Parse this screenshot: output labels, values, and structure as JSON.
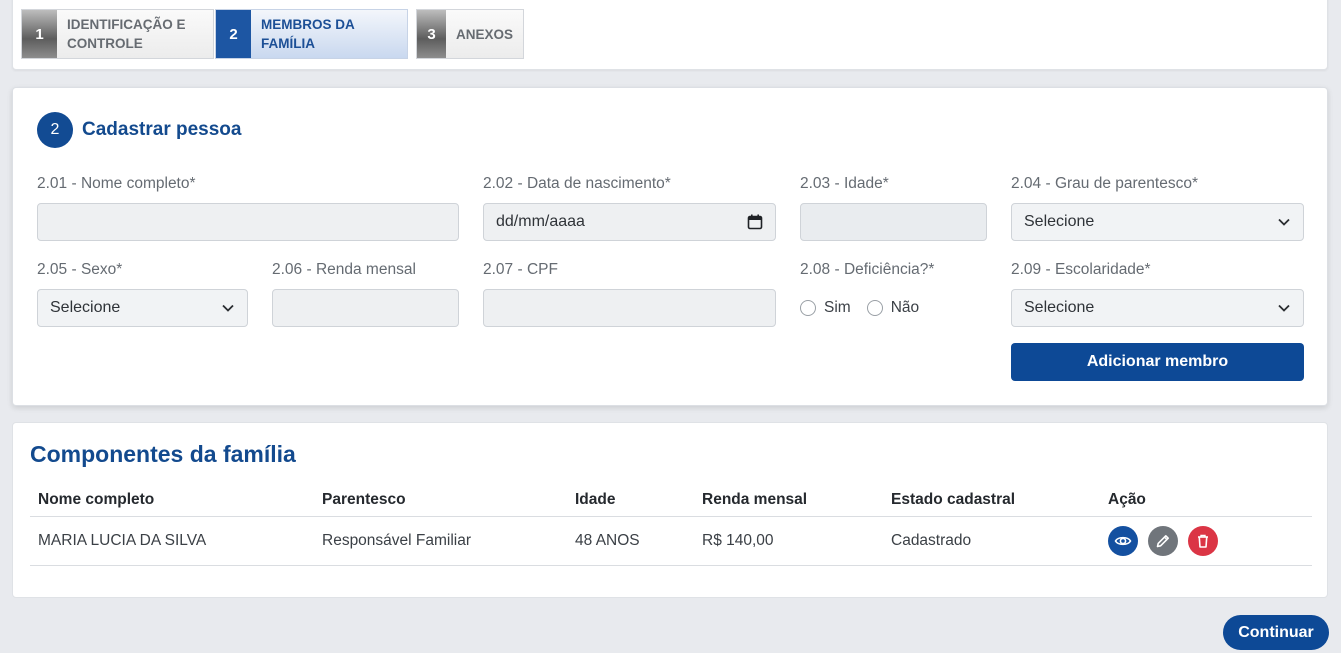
{
  "stepper": {
    "steps": [
      {
        "number": "1",
        "label_line1": "IDENTIFICAÇÃO E",
        "label_line2": "CONTROLE"
      },
      {
        "number": "2",
        "label_line1": "MEMBROS DA",
        "label_line2": "FAMÍLIA"
      },
      {
        "number": "3",
        "label_line1": "ANEXOS",
        "label_line2": ""
      }
    ],
    "active_step": 2
  },
  "form": {
    "section_number": "2",
    "section_title": "Cadastrar pessoa",
    "fields": {
      "nome": {
        "label": "2.01 - Nome completo*",
        "value": ""
      },
      "nascimento": {
        "label": "2.02 - Data de nascimento*",
        "value": "dd/mm/aaaa"
      },
      "idade": {
        "label": "2.03 - Idade*",
        "value": ""
      },
      "parentesco": {
        "label": "2.04 - Grau de parentesco*",
        "value": "Selecione"
      },
      "sexo": {
        "label": "2.05 - Sexo*",
        "value": "Selecione"
      },
      "renda": {
        "label": "2.06 - Renda mensal",
        "value": ""
      },
      "cpf": {
        "label": "2.07 - CPF",
        "value": ""
      },
      "deficiencia": {
        "label": "2.08 - Deficiência?*",
        "option_yes": "Sim",
        "option_no": "Não"
      },
      "escolaridade": {
        "label": "2.09 - Escolaridade*",
        "value": "Selecione"
      }
    },
    "add_button": "Adicionar membro"
  },
  "table": {
    "title": "Componentes da família",
    "headers": [
      "Nome completo",
      "Parentesco",
      "Idade",
      "Renda mensal",
      "Estado cadastral",
      "Ação"
    ],
    "rows": [
      {
        "nome": "MARIA LUCIA DA SILVA",
        "parentesco": "Responsável Familiar",
        "idade": "48 ANOS",
        "renda": "R$ 140,00",
        "estado": "Cadastrado"
      }
    ],
    "actions": [
      "eye-icon",
      "pencil-icon",
      "trash-icon"
    ]
  },
  "footer": {
    "continue_button": "Continuar"
  },
  "colors": {
    "primary": "#0d4996",
    "danger": "#db3545",
    "secondary": "#70757b",
    "background": "#e8eaee"
  }
}
